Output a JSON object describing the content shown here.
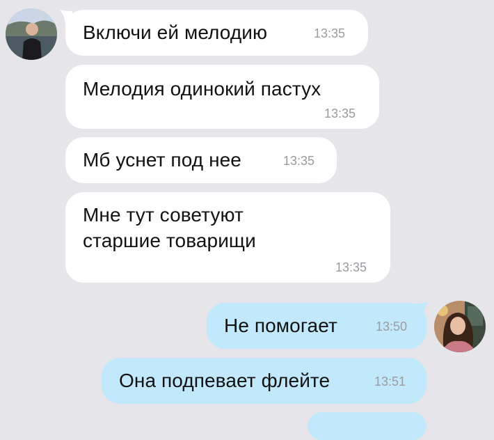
{
  "messages": [
    {
      "text": "Включи ей мелодию",
      "time": "13:35",
      "direction": "incoming"
    },
    {
      "text": "Мелодия одинокий пастух",
      "time": "13:35",
      "direction": "incoming"
    },
    {
      "text": "Мб уснет под нее",
      "time": "13:35",
      "direction": "incoming"
    },
    {
      "line1": "Мне тут советуют",
      "line2": "старшие товарищи",
      "time": "13:35",
      "direction": "incoming"
    },
    {
      "text": "Не помогает",
      "time": "13:50",
      "direction": "outgoing"
    },
    {
      "text": "Она подпевает флейте",
      "time": "13:51",
      "direction": "outgoing"
    }
  ],
  "colors": {
    "background": "#e6e6ea",
    "incoming_bubble": "#ffffff",
    "outgoing_bubble": "#c2e9fb",
    "time_text": "#9a9aa0"
  },
  "avatars": {
    "incoming": "man-avatar-icon",
    "outgoing": "woman-avatar-icon"
  }
}
